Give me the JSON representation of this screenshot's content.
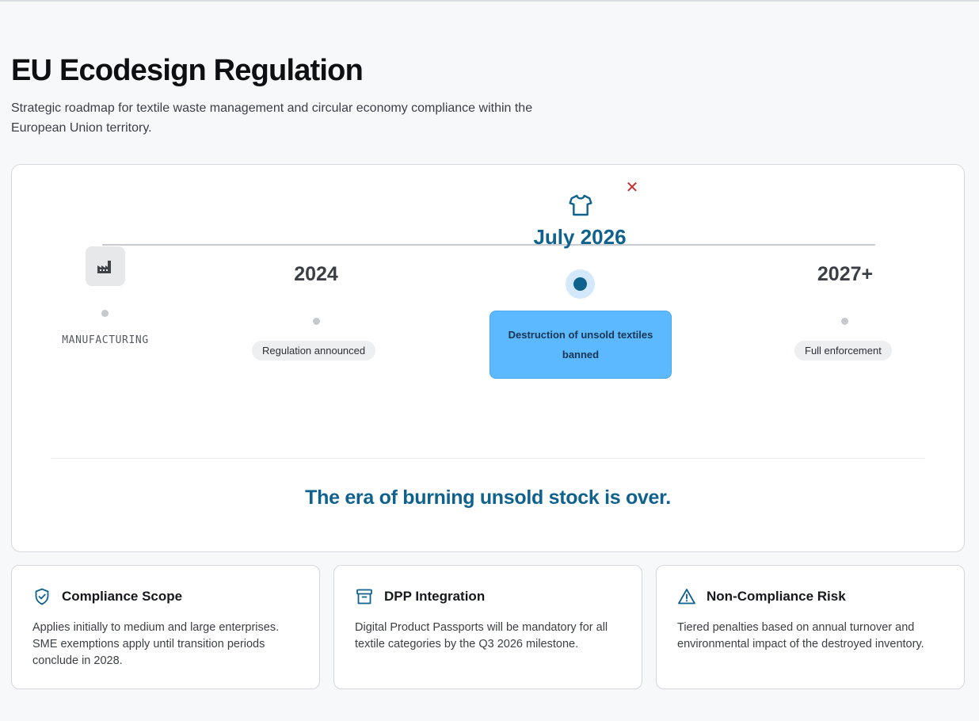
{
  "header": {
    "title": "EU Ecodesign Regulation",
    "subtitle": "Strategic roadmap for textile waste management and circular economy compliance within the European Union territory."
  },
  "timeline": {
    "start_label": "MANUFACTURING",
    "milestones": [
      {
        "year": "2024",
        "label": "Regulation announced"
      },
      {
        "year": "July 2026",
        "label": "Destruction of unsold textiles banned"
      },
      {
        "year": "2027+",
        "label": "Full enforcement"
      }
    ],
    "tagline": "The era of burning unsold stock is over."
  },
  "cards": [
    {
      "title": "Compliance Scope",
      "body": "Applies initially to medium and large enterprises. SME exemptions apply until transition periods conclude in 2028.",
      "icon": "shield-check-icon"
    },
    {
      "title": "DPP Integration",
      "body": "Digital Product Passports will be mandatory for all textile categories by the Q3 2026 milestone.",
      "icon": "archive-box-icon"
    },
    {
      "title": "Non-Compliance Risk",
      "body": "Tiered penalties based on annual turnover and environmental impact of the destroyed inventory.",
      "icon": "warning-triangle-icon"
    }
  ],
  "colors": {
    "accent": "#0f628e",
    "highlight_fill": "#5cb8ff",
    "close": "#c53030"
  }
}
